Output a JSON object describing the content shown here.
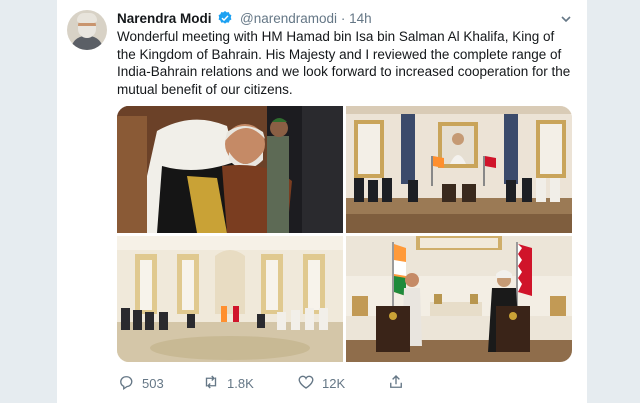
{
  "tweet": {
    "author_name": "Narendra Modi",
    "handle": "@narendramodi",
    "separator": "·",
    "time": "14h",
    "text": "Wonderful meeting with HM Hamad bin Isa bin Salman Al Khalifa, King of\nthe Kingdom of Bahrain. His Majesty and I reviewed the complete range of\nIndia-Bahrain relations and we look forward to increased cooperation for the\nmutual benefit of our citizens."
  },
  "actions": {
    "reply_count": "503",
    "retweet_count": "1.8K",
    "like_count": "12K"
  },
  "icons": {
    "verified": "verified-badge-icon",
    "reply": "reply-icon",
    "retweet": "retweet-icon",
    "like": "heart-icon",
    "share": "share-icon",
    "menu": "chevron-down-icon"
  },
  "colors": {
    "verified_blue": "#1da1f2",
    "text_primary": "#14171a",
    "text_secondary": "#657786",
    "page_background": "#e6ecf0"
  }
}
